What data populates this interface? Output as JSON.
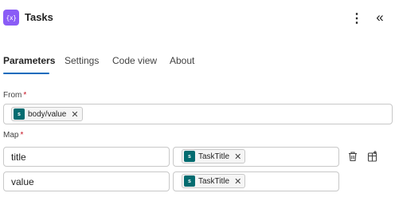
{
  "header": {
    "icon_text": "{x}",
    "icon_name": "variable-icon",
    "title": "Tasks",
    "more_icon": "⋮",
    "collapse_icon": "«"
  },
  "tabs": [
    {
      "label": "Parameters",
      "active": true
    },
    {
      "label": "Settings",
      "active": false
    },
    {
      "label": "Code view",
      "active": false
    },
    {
      "label": "About",
      "active": false
    }
  ],
  "from": {
    "label": "From",
    "required_mark": "*",
    "token": {
      "icon_text": "s",
      "label": "body/value",
      "remove": "✕"
    }
  },
  "map": {
    "label": "Map",
    "required_mark": "*",
    "rows": [
      {
        "key": "title",
        "token": {
          "icon_text": "s",
          "label": "TaskTitle",
          "remove": "✕"
        }
      },
      {
        "key": "value",
        "token": {
          "icon_text": "s",
          "label": "TaskTitle",
          "remove": "✕"
        }
      }
    ]
  },
  "colors": {
    "accent": "#0f6cbd",
    "app_icon": "#8a5cf6",
    "sharepoint_icon": "#036c70",
    "required": "#c50f1f"
  }
}
